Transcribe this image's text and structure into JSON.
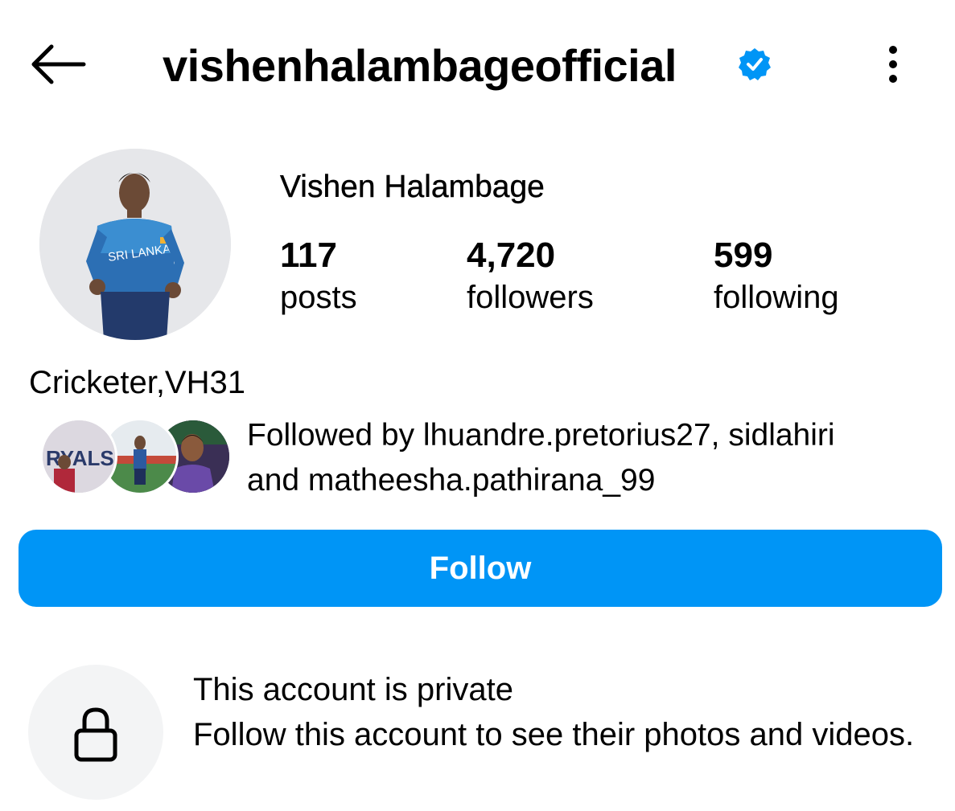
{
  "header": {
    "username": "vishenhalambageofficial",
    "back_icon": "arrow-left-icon",
    "verified_icon": "verified-badge-icon",
    "more_icon": "vertical-dots-icon"
  },
  "profile": {
    "display_name": "Vishen Halambage",
    "stats": [
      {
        "count": "117",
        "label": "posts"
      },
      {
        "count": "4,720",
        "label": "followers"
      },
      {
        "count": "599",
        "label": "following"
      }
    ],
    "bio": "Cricketer,VH31"
  },
  "followed_by": {
    "text_line1": "Followed by lhuandre.pretorius27, sidlahiri",
    "text_line2": "and matheesha.pathirana_99",
    "avatar_text": "RYALS"
  },
  "follow_button": {
    "label": "Follow"
  },
  "private_notice": {
    "icon": "lock-icon",
    "title": "This account is private",
    "subtitle": "Follow this account to see their photos and videos."
  },
  "colors": {
    "accent": "#0095f6",
    "verified": "#0095f6",
    "lock_bg": "#f3f4f5"
  }
}
